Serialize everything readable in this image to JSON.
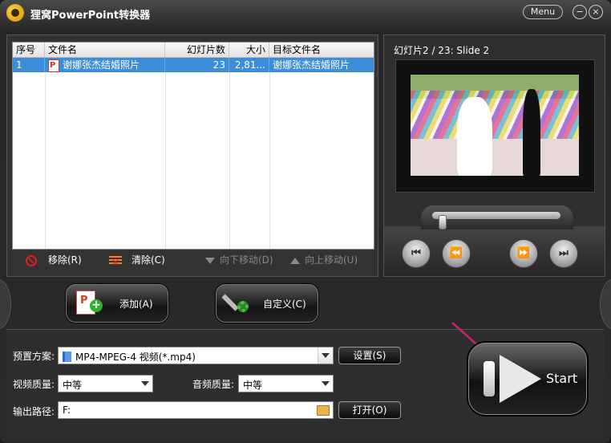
{
  "window": {
    "title": "狸窝PowerPoint转换器",
    "menu_label": "Menu",
    "min_label": "−",
    "close_label": "×"
  },
  "file_list": {
    "columns": [
      "序号",
      "文件名",
      "幻灯片数",
      "大小",
      "目标文件名"
    ],
    "rows": [
      {
        "index": "1",
        "filename": "谢娜张杰结婚照片",
        "slides": "23",
        "size": "2,81...",
        "target": "谢娜张杰结婚照片"
      }
    ]
  },
  "list_actions": {
    "remove": "移除(R)",
    "clear": "清除(C)",
    "move_down": "向下移动(D)",
    "move_up": "向上移动(U)"
  },
  "buttons": {
    "add": "添加(A)",
    "custom": "自定义(C)"
  },
  "preview": {
    "title": "幻灯片2 / 23: Slide 2",
    "seek_position": 0.05
  },
  "settings": {
    "preset_label": "预置方案:",
    "preset_value": "MP4-MPEG-4 视频(*.mp4)",
    "settings_button": "设置(S)",
    "video_quality_label": "视频质量:",
    "video_quality_value": "中等",
    "audio_quality_label": "音频质量:",
    "audio_quality_value": "中等",
    "output_label": "输出路径:",
    "output_value": "F:",
    "open_button": "打开(O)"
  },
  "start": {
    "label": "Start"
  },
  "colors": {
    "selection": "#3c8ed8",
    "accent_arrow": "#d02070"
  }
}
